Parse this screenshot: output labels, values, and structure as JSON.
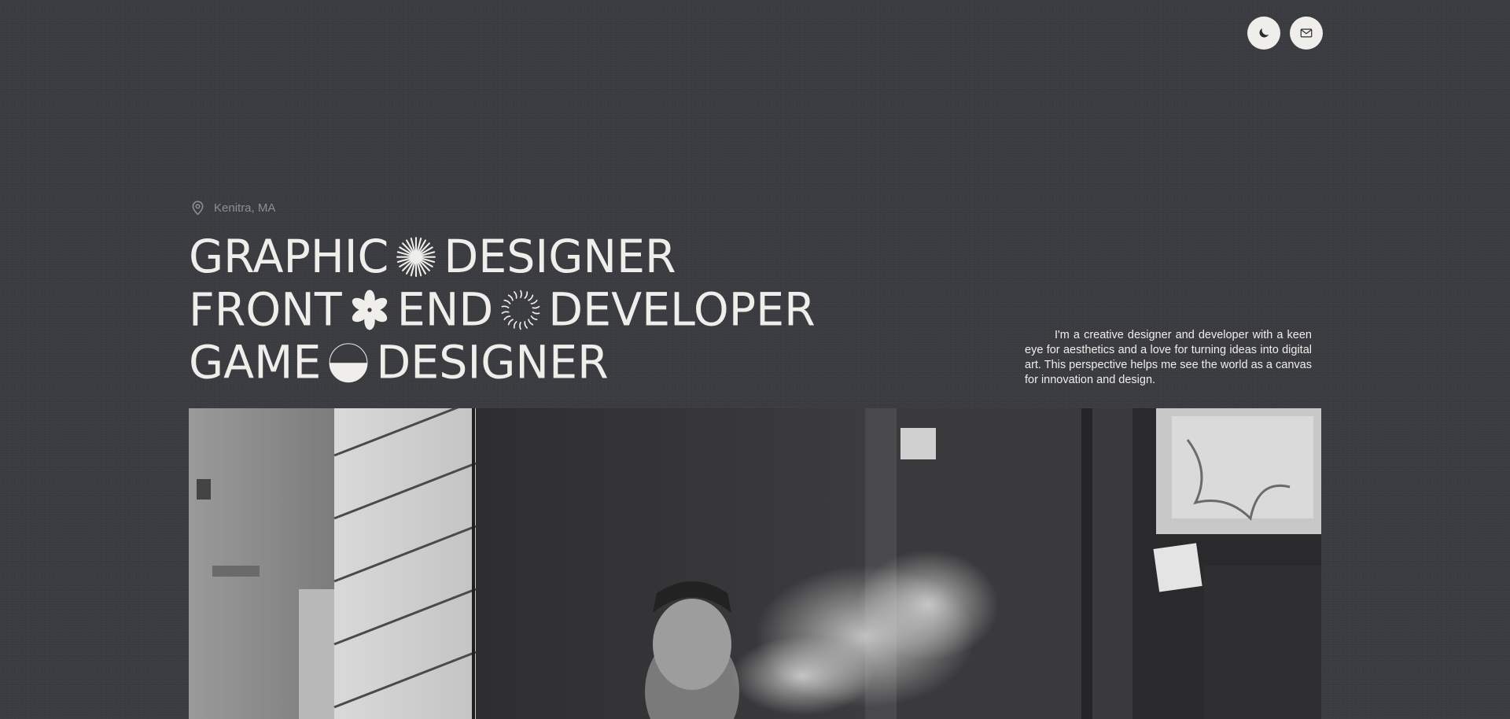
{
  "header": {
    "theme_toggle_icon": "moon-icon",
    "contact_icon": "mail-icon"
  },
  "location": {
    "icon": "map-pin-icon",
    "text": "Kenitra, MA"
  },
  "headline": {
    "line1": {
      "word1": "GRAPHIC",
      "icon": "sunburst-icon",
      "word2": "DESIGNER"
    },
    "line2": {
      "word1": "FRONT",
      "icon1": "flower-icon",
      "word2": "END",
      "icon2": "wavy-circle-icon",
      "word3": "DEVELOPER"
    },
    "line3": {
      "word1": "GAME",
      "icon": "half-circle-icon",
      "word2": "DESIGNER"
    }
  },
  "bio": {
    "text": "I'm a creative designer and developer with a keen eye for aesthetics and a love for turning ideas into digital art. This perspective helps me see the world as a canvas for innovation and design."
  },
  "hero_image": {
    "subject": "black-and-white photo of a man smoking in a storefront"
  },
  "colors": {
    "background": "#3a3b40",
    "text": "#efeeea",
    "muted": "#8d8e93"
  }
}
